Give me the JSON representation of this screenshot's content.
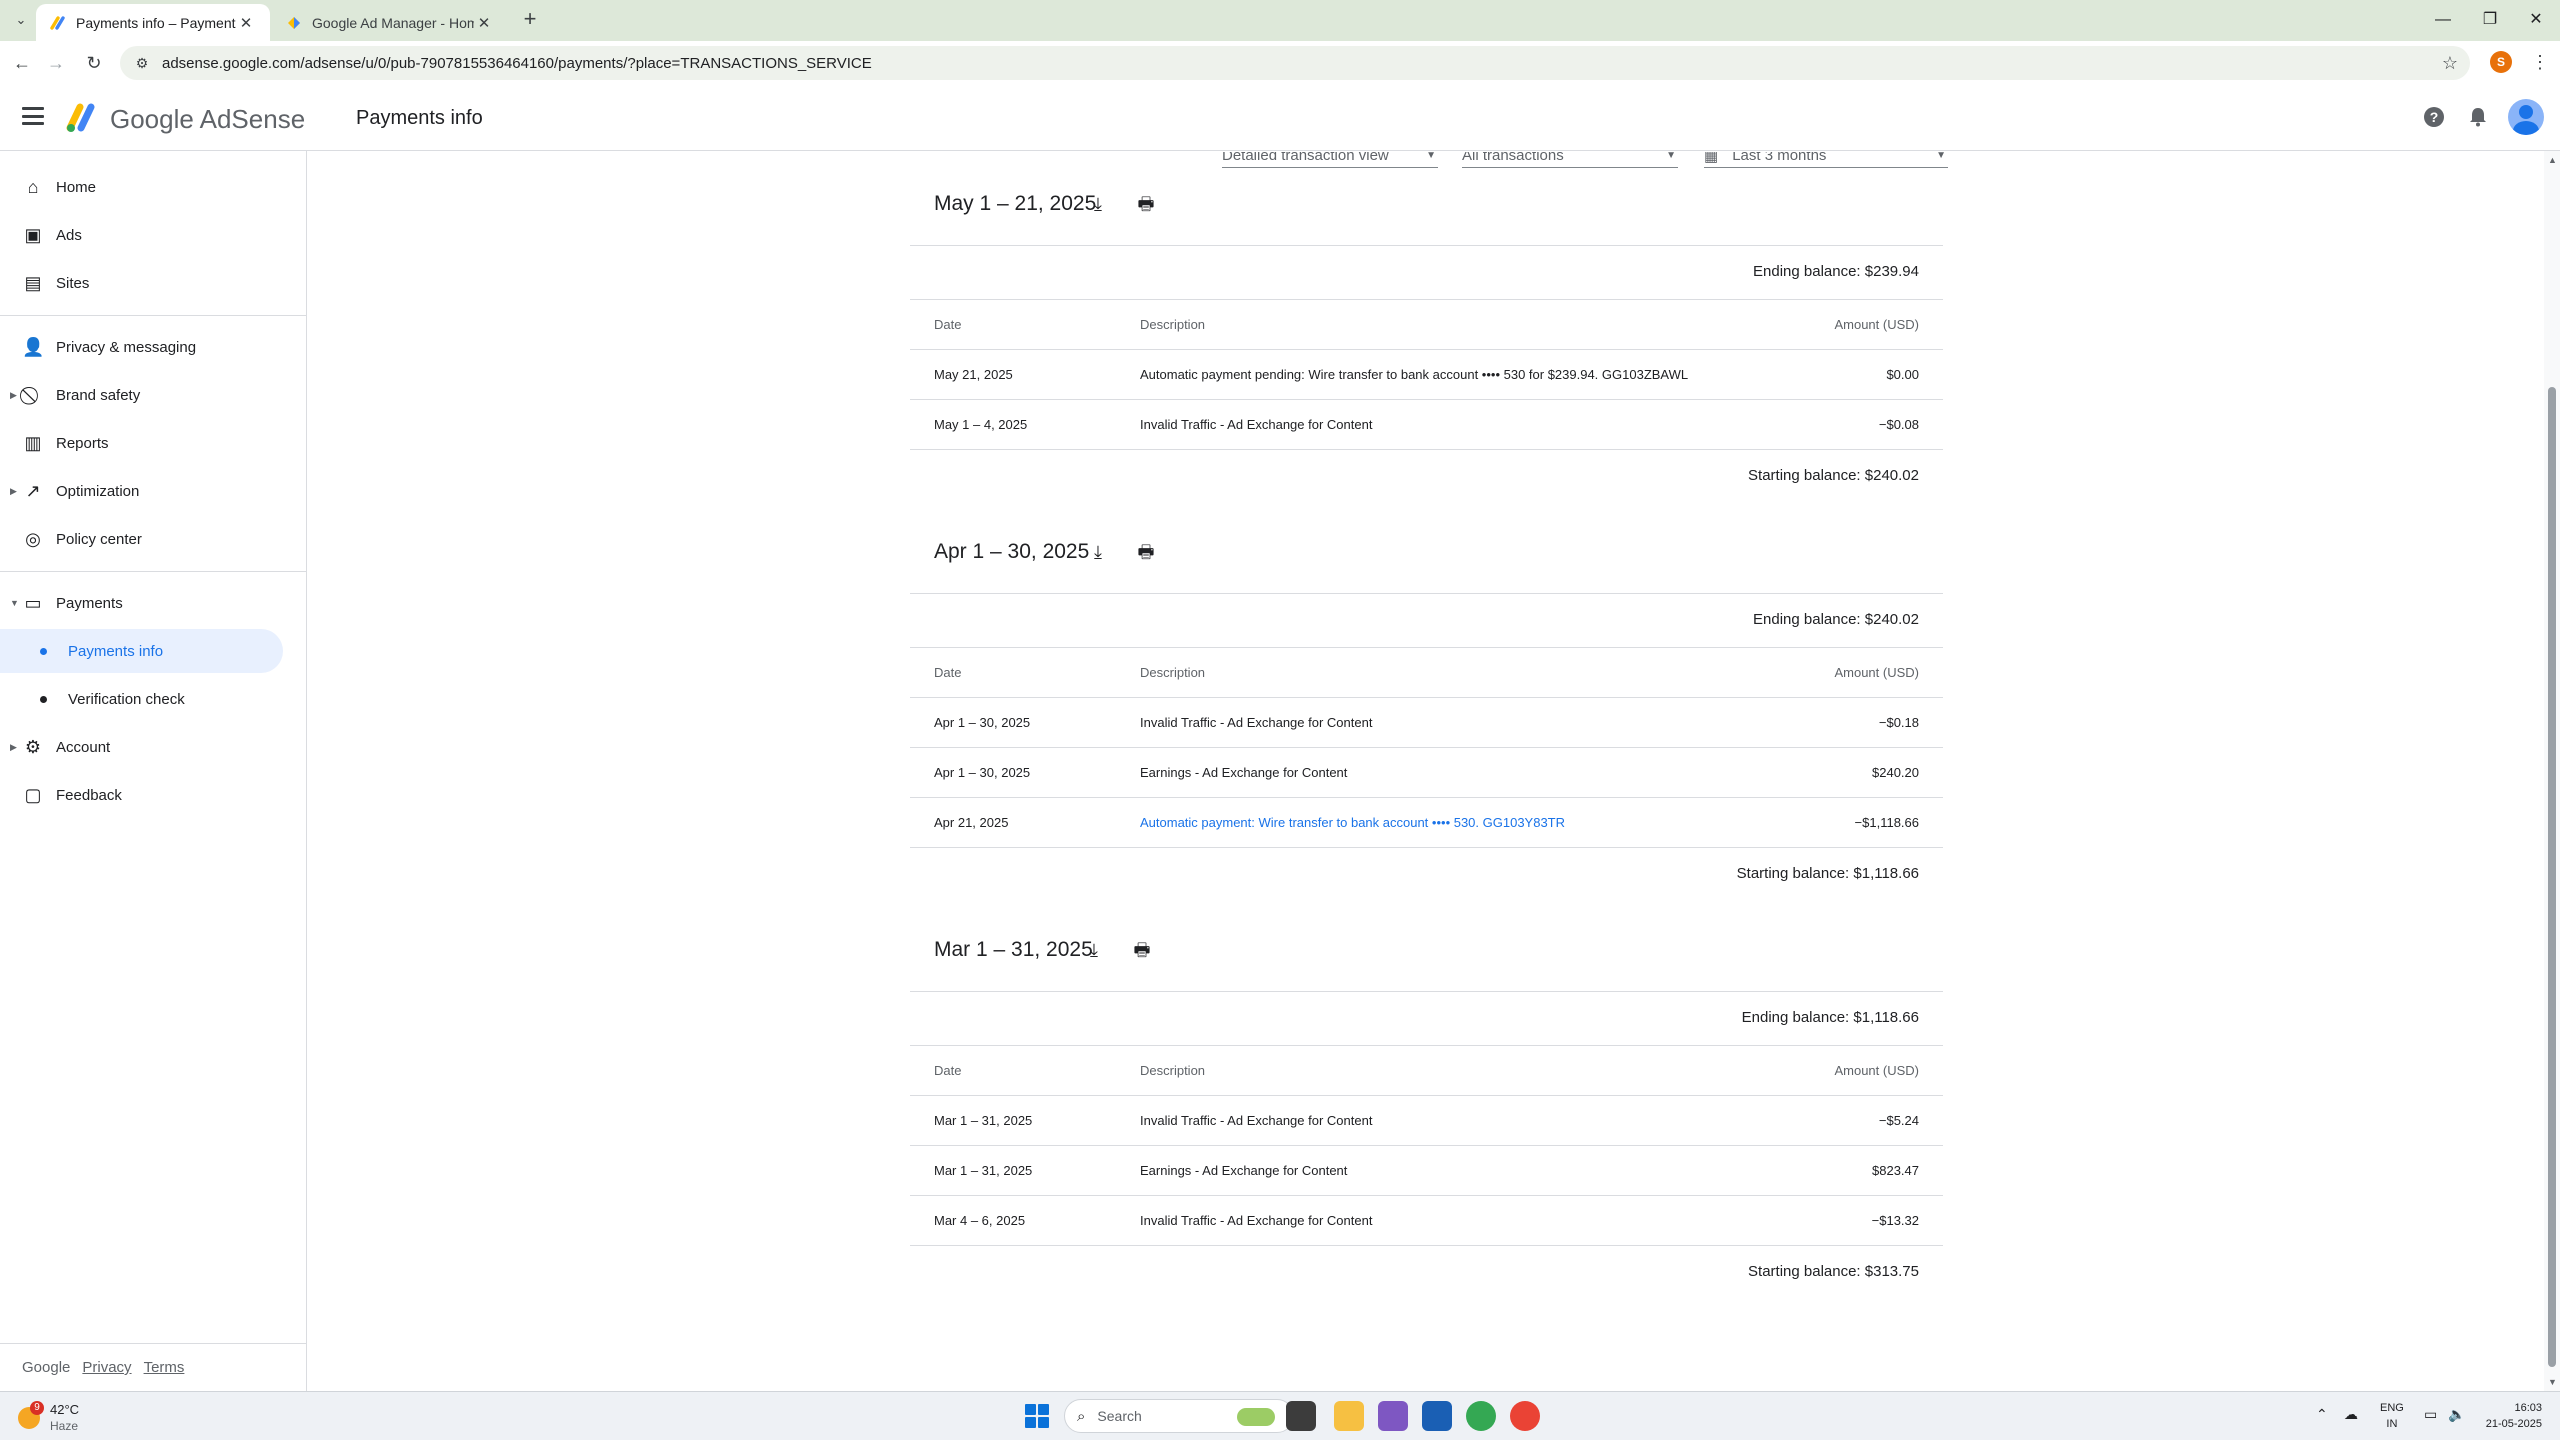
{
  "browser": {
    "tabs": [
      {
        "title": "Payments info – Payments – Go",
        "active": true
      },
      {
        "title": "Google Ad Manager - Home",
        "active": false
      }
    ],
    "new_tab": "+",
    "url": "adsense.google.com/adsense/u/0/pub-7907815536464160/payments/?place=TRANSACTIONS_SERVICE",
    "profile_initial": "S",
    "controls": {
      "minimize": "—",
      "restore": "❐",
      "close": "✕"
    }
  },
  "app": {
    "product_name": "Google AdSense",
    "page_title": "Payments info",
    "brand_colors": {
      "blue": "#4285f4",
      "yellow": "#fbbc04",
      "green": "#34a853",
      "accent": "#1a73e8"
    }
  },
  "sidebar": {
    "items": [
      {
        "label": "Home",
        "icon": "home-icon"
      },
      {
        "label": "Ads",
        "icon": "ads-icon"
      },
      {
        "label": "Sites",
        "icon": "sites-icon"
      },
      {
        "label": "Privacy & messaging",
        "icon": "person-icon"
      },
      {
        "label": "Brand safety",
        "icon": "block-icon",
        "expandable": true
      },
      {
        "label": "Reports",
        "icon": "reports-icon"
      },
      {
        "label": "Optimization",
        "icon": "trending-icon",
        "expandable": true
      },
      {
        "label": "Policy center",
        "icon": "policy-icon"
      },
      {
        "label": "Payments",
        "icon": "payments-icon",
        "expanded": true
      },
      {
        "label": "Payments info",
        "sub": true,
        "selected": true
      },
      {
        "label": "Verification check",
        "sub": true
      },
      {
        "label": "Account",
        "icon": "gear-icon",
        "expandable": true
      },
      {
        "label": "Feedback",
        "icon": "feedback-icon"
      }
    ],
    "footer": {
      "google": "Google",
      "privacy": "Privacy",
      "terms": "Terms"
    }
  },
  "filters": {
    "view": "Detailed transaction view",
    "type": "All transactions",
    "range": "Last 3 months"
  },
  "table_headers": {
    "date": "Date",
    "description": "Description",
    "amount": "Amount (USD)"
  },
  "periods": [
    {
      "title": "May 1 – 21, 2025",
      "ending_balance": "Ending balance: $239.94",
      "rows": [
        {
          "date": "May 21, 2025",
          "description": "Automatic payment pending: Wire transfer to bank account •••• 530 for $239.94. GG103ZBAWL",
          "amount": "$0.00"
        },
        {
          "date": "May 1 – 4, 2025",
          "description": "Invalid Traffic - Ad Exchange for Content",
          "amount": "−$0.08"
        }
      ],
      "starting_balance": "Starting balance: $240.02"
    },
    {
      "title": "Apr 1 – 30, 2025",
      "ending_balance": "Ending balance: $240.02",
      "rows": [
        {
          "date": "Apr 1 – 30, 2025",
          "description": "Invalid Traffic - Ad Exchange for Content",
          "amount": "−$0.18"
        },
        {
          "date": "Apr 1 – 30, 2025",
          "description": "Earnings - Ad Exchange for Content",
          "amount": "$240.20"
        },
        {
          "date": "Apr 21, 2025",
          "description": "Automatic payment: Wire transfer to bank account •••• 530. GG103Y83TR",
          "amount": "−$1,118.66",
          "link": true
        }
      ],
      "starting_balance": "Starting balance: $1,118.66"
    },
    {
      "title": "Mar 1 – 31, 2025",
      "ending_balance": "Ending balance: $1,118.66",
      "rows": [
        {
          "date": "Mar 1 – 31, 2025",
          "description": "Invalid Traffic - Ad Exchange for Content",
          "amount": "−$5.24"
        },
        {
          "date": "Mar 1 – 31, 2025",
          "description": "Earnings - Ad Exchange for Content",
          "amount": "$823.47"
        },
        {
          "date": "Mar 4 – 6, 2025",
          "description": "Invalid Traffic - Ad Exchange for Content",
          "amount": "−$13.32"
        }
      ],
      "starting_balance": "Starting balance: $313.75"
    }
  ],
  "taskbar": {
    "weather_temp": "42°C",
    "weather_cond": "Haze",
    "weather_badge": "9",
    "search_label": "Search",
    "lang_line1": "ENG",
    "lang_line2": "IN",
    "time": "16:03",
    "date": "21-05-2025"
  }
}
